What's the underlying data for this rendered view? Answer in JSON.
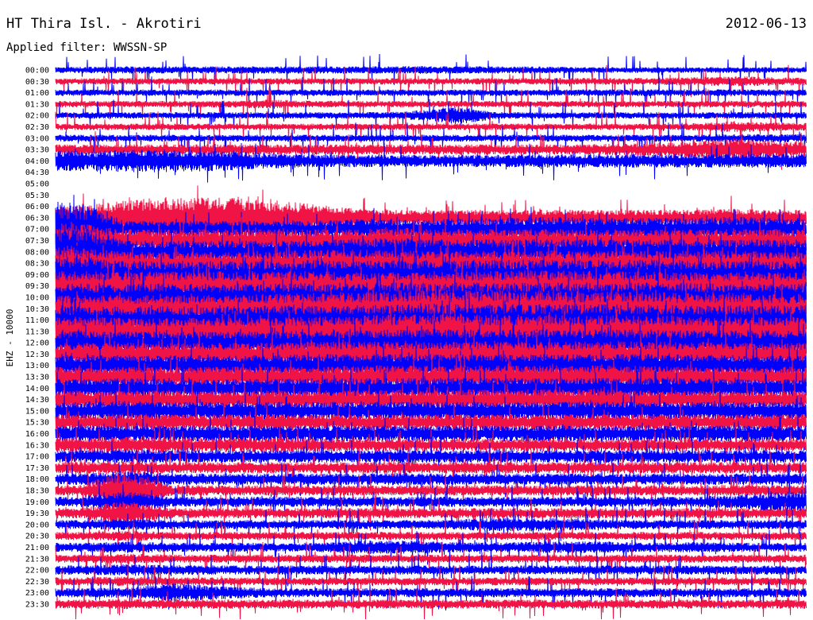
{
  "chart_data": {
    "type": "line",
    "title": "HT Thira Isl. - Akrotiri",
    "date": "2012-06-13",
    "subtitle": "Applied filter: WWSSN-SP",
    "ylabel": "EHZ - 10000",
    "grid": false,
    "background": "#ffffff",
    "series": [
      {
        "name": "00:00",
        "color": "#0000ff",
        "amplitude": [
          0.28,
          0.32,
          0.32,
          0.32,
          0.32,
          0.32,
          0.32,
          0.35,
          0.32,
          0.32,
          0.3,
          0.25,
          0.25,
          0.25,
          0.25,
          0.25
        ]
      },
      {
        "name": "00:30",
        "color": "#f01446",
        "amplitude": [
          0.28,
          0.28,
          0.28,
          0.28,
          0.28,
          0.28,
          0.28,
          0.28,
          0.28,
          0.28,
          0.3,
          0.3,
          0.3,
          0.35,
          0.45,
          0.35
        ]
      },
      {
        "name": "01:00",
        "color": "#0000ff",
        "amplitude": [
          0.28,
          0.28,
          0.28,
          0.28,
          0.28,
          0.28,
          0.28,
          0.28,
          0.28,
          0.28,
          0.28,
          0.3,
          0.3,
          0.3,
          0.3,
          0.3
        ]
      },
      {
        "name": "01:30",
        "color": "#f01446",
        "amplitude": [
          0.28,
          0.28,
          0.28,
          0.3,
          0.4,
          0.3,
          0.28,
          0.28,
          0.28,
          0.28,
          0.28,
          0.28,
          0.28,
          0.28,
          0.3,
          0.3
        ]
      },
      {
        "name": "02:00",
        "color": "#0000ff",
        "amplitude": [
          0.28,
          0.28,
          0.28,
          0.28,
          0.28,
          0.28,
          0.28,
          0.35,
          0.8,
          0.3,
          0.28,
          0.28,
          0.28,
          0.28,
          0.3,
          0.3
        ]
      },
      {
        "name": "02:30",
        "color": "#f01446",
        "amplitude": [
          0.28,
          0.28,
          0.28,
          0.28,
          0.28,
          0.28,
          0.28,
          0.28,
          0.28,
          0.28,
          0.28,
          0.28,
          0.28,
          0.3,
          0.5,
          0.35
        ]
      },
      {
        "name": "03:00",
        "color": "#0000ff",
        "amplitude": [
          0.3,
          0.3,
          0.3,
          0.3,
          0.3,
          0.3,
          0.3,
          0.3,
          0.3,
          0.3,
          0.3,
          0.3,
          0.3,
          0.3,
          0.35,
          0.35
        ]
      },
      {
        "name": "03:30",
        "color": "#f01446",
        "amplitude": [
          0.45,
          0.45,
          0.45,
          0.45,
          0.45,
          0.45,
          0.45,
          0.45,
          0.45,
          0.45,
          0.45,
          0.5,
          0.55,
          0.7,
          1.0,
          0.75
        ]
      },
      {
        "name": "04:00",
        "color": "#0000ff",
        "amplitude": [
          0.9,
          1.0,
          1.0,
          0.9,
          0.7,
          0.55,
          0.55,
          0.55,
          0.55,
          0.55,
          0.6,
          0.6,
          0.6,
          0.6,
          0.6,
          0.6
        ]
      },
      {
        "name": "04:30",
        "color": "#f01446",
        "amplitude": [
          null,
          null,
          null,
          null,
          null,
          null,
          null,
          null,
          null,
          null,
          null,
          null,
          null,
          null,
          null,
          null
        ]
      },
      {
        "name": "05:00",
        "color": "#0000ff",
        "amplitude": [
          null,
          null,
          null,
          null,
          null,
          null,
          null,
          null,
          null,
          null,
          null,
          null,
          null,
          null,
          null,
          null
        ]
      },
      {
        "name": "05:30",
        "color": "#f01446",
        "amplitude": [
          null,
          null,
          null,
          null,
          null,
          null,
          null,
          null,
          null,
          null,
          null,
          null,
          null,
          null,
          null,
          null
        ]
      },
      {
        "name": "06:00",
        "color": "#0000ff",
        "amplitude": [
          null,
          null,
          null,
          null,
          null,
          null,
          null,
          null,
          null,
          null,
          null,
          null,
          null,
          null,
          null,
          null
        ]
      },
      {
        "name": "06:30",
        "color": "#f01446",
        "amplitude": [
          1.0,
          1.6,
          1.9,
          1.8,
          1.6,
          1.2,
          0.8,
          0.7,
          0.7,
          0.7,
          0.7,
          0.7,
          0.7,
          0.7,
          0.8,
          0.7
        ]
      },
      {
        "name": "07:00",
        "color": "#0000ff",
        "amplitude": [
          2.4,
          0.7,
          0.7,
          0.7,
          0.7,
          0.7,
          0.9,
          0.9,
          0.9,
          1.0,
          1.1,
          1.0,
          1.0,
          1.0,
          1.1,
          1.0
        ]
      },
      {
        "name": "07:30",
        "color": "#f01446",
        "amplitude": [
          1.5,
          1.0,
          1.0,
          1.0,
          1.0,
          1.0,
          1.0,
          1.1,
          1.0,
          1.0,
          1.0,
          1.0,
          1.0,
          1.0,
          1.0,
          1.0
        ]
      },
      {
        "name": "08:00",
        "color": "#0000ff",
        "amplitude": [
          2.4,
          1.0,
          1.0,
          1.0,
          1.0,
          1.0,
          1.2,
          1.2,
          1.1,
          1.1,
          1.1,
          1.1,
          1.1,
          1.1,
          1.1,
          1.1
        ]
      },
      {
        "name": "08:30",
        "color": "#f01446",
        "amplitude": [
          1.4,
          1.0,
          1.0,
          1.0,
          1.0,
          1.2,
          1.2,
          1.1,
          1.1,
          1.1,
          1.1,
          1.1,
          1.1,
          1.1,
          1.1,
          1.0
        ]
      },
      {
        "name": "09:00",
        "color": "#0000ff",
        "amplitude": [
          1.6,
          1.2,
          1.2,
          1.2,
          1.2,
          1.3,
          1.2,
          1.3,
          1.3,
          1.3,
          1.3,
          1.3,
          1.3,
          1.2,
          1.2,
          1.2
        ]
      },
      {
        "name": "09:30",
        "color": "#f01446",
        "amplitude": [
          1.3,
          1.3,
          1.3,
          1.3,
          1.3,
          1.3,
          1.2,
          1.3,
          1.3,
          1.3,
          1.4,
          1.3,
          1.3,
          1.2,
          1.2,
          1.2
        ]
      },
      {
        "name": "10:00",
        "color": "#0000ff",
        "amplitude": [
          1.2,
          1.2,
          1.2,
          1.2,
          1.2,
          1.3,
          1.3,
          1.3,
          1.3,
          1.3,
          1.3,
          1.3,
          1.3,
          1.3,
          1.2,
          1.2
        ]
      },
      {
        "name": "10:30",
        "color": "#f01446",
        "amplitude": [
          1.2,
          1.2,
          1.2,
          1.2,
          1.3,
          1.4,
          1.5,
          1.7,
          1.7,
          1.6,
          1.6,
          1.5,
          1.5,
          1.4,
          1.4,
          1.3
        ]
      },
      {
        "name": "11:00",
        "color": "#0000ff",
        "amplitude": [
          1.2,
          1.2,
          1.2,
          1.2,
          1.3,
          1.3,
          1.3,
          1.4,
          1.4,
          1.4,
          1.4,
          1.4,
          1.4,
          1.3,
          1.3,
          1.3
        ]
      },
      {
        "name": "11:30",
        "color": "#f01446",
        "amplitude": [
          1.3,
          1.2,
          1.2,
          1.2,
          1.2,
          1.3,
          1.4,
          1.5,
          1.6,
          1.5,
          1.5,
          1.4,
          1.4,
          1.3,
          1.3,
          1.3
        ]
      },
      {
        "name": "12:00",
        "color": "#0000ff",
        "amplitude": [
          1.0,
          1.0,
          1.0,
          1.0,
          1.0,
          1.1,
          1.1,
          1.2,
          1.2,
          1.2,
          1.2,
          1.2,
          1.2,
          1.1,
          1.1,
          1.1
        ]
      },
      {
        "name": "12:30",
        "color": "#f01446",
        "amplitude": [
          1.0,
          1.0,
          1.0,
          1.0,
          1.0,
          1.1,
          1.1,
          1.1,
          1.1,
          1.1,
          1.1,
          1.1,
          1.1,
          1.1,
          1.0,
          1.0
        ]
      },
      {
        "name": "13:00",
        "color": "#0000ff",
        "amplitude": [
          0.9,
          0.9,
          0.9,
          0.9,
          0.9,
          1.0,
          1.0,
          1.0,
          1.0,
          1.0,
          1.0,
          1.0,
          1.0,
          1.0,
          0.9,
          0.9
        ]
      },
      {
        "name": "13:30",
        "color": "#f01446",
        "amplitude": [
          0.9,
          0.9,
          0.9,
          0.9,
          0.9,
          0.9,
          1.0,
          1.0,
          1.0,
          1.0,
          1.0,
          1.0,
          1.0,
          0.9,
          0.9,
          0.9
        ]
      },
      {
        "name": "14:00",
        "color": "#0000ff",
        "amplitude": [
          0.8,
          0.9,
          0.8,
          0.8,
          0.8,
          0.9,
          0.9,
          0.9,
          0.9,
          0.9,
          0.9,
          0.9,
          0.9,
          0.9,
          0.8,
          0.8
        ]
      },
      {
        "name": "14:30",
        "color": "#f01446",
        "amplitude": [
          0.8,
          0.8,
          0.8,
          0.8,
          0.8,
          0.8,
          0.8,
          0.9,
          0.9,
          0.9,
          0.9,
          0.9,
          0.8,
          0.8,
          0.8,
          0.8
        ]
      },
      {
        "name": "15:00",
        "color": "#0000ff",
        "amplitude": [
          0.8,
          0.9,
          0.8,
          0.8,
          0.8,
          0.8,
          0.8,
          0.8,
          0.8,
          0.8,
          0.8,
          0.8,
          0.8,
          0.8,
          0.8,
          0.8
        ]
      },
      {
        "name": "15:30",
        "color": "#f01446",
        "amplitude": [
          0.7,
          0.8,
          0.7,
          0.7,
          0.7,
          0.7,
          0.7,
          0.7,
          0.7,
          0.7,
          0.7,
          0.7,
          0.7,
          0.7,
          0.7,
          0.7
        ]
      },
      {
        "name": "16:00",
        "color": "#0000ff",
        "amplitude": [
          0.7,
          0.7,
          0.7,
          0.7,
          0.7,
          0.7,
          0.7,
          0.7,
          0.7,
          0.7,
          0.7,
          0.7,
          0.7,
          0.7,
          0.7,
          0.7
        ]
      },
      {
        "name": "16:30",
        "color": "#f01446",
        "amplitude": [
          0.65,
          0.75,
          0.65,
          0.65,
          0.65,
          0.6,
          0.55,
          0.55,
          0.55,
          0.55,
          0.55,
          0.55,
          0.55,
          0.55,
          0.55,
          0.55
        ]
      },
      {
        "name": "17:00",
        "color": "#0000ff",
        "amplitude": [
          0.55,
          0.6,
          0.55,
          0.55,
          0.55,
          0.55,
          0.55,
          0.6,
          0.55,
          0.55,
          0.55,
          0.55,
          0.55,
          0.55,
          0.55,
          0.55
        ]
      },
      {
        "name": "17:30",
        "color": "#f01446",
        "amplitude": [
          0.5,
          0.6,
          0.5,
          0.5,
          0.5,
          0.5,
          0.5,
          0.5,
          0.5,
          0.5,
          0.5,
          0.5,
          0.5,
          0.5,
          0.5,
          0.5
        ]
      },
      {
        "name": "18:00",
        "color": "#0000ff",
        "amplitude": [
          0.5,
          0.7,
          0.5,
          0.5,
          0.5,
          0.5,
          0.5,
          0.55,
          0.5,
          0.5,
          0.5,
          0.5,
          0.5,
          0.5,
          0.5,
          0.5
        ]
      },
      {
        "name": "18:30",
        "color": "#f01446",
        "amplitude": [
          0.45,
          1.8,
          0.5,
          0.45,
          0.45,
          0.45,
          0.45,
          0.45,
          0.45,
          0.45,
          0.45,
          0.45,
          0.45,
          0.45,
          0.5,
          0.45
        ]
      },
      {
        "name": "19:00",
        "color": "#0000ff",
        "amplitude": [
          0.45,
          0.9,
          0.45,
          0.45,
          0.45,
          0.45,
          0.45,
          0.45,
          0.45,
          0.45,
          0.45,
          0.45,
          0.45,
          0.45,
          0.6,
          0.9
        ]
      },
      {
        "name": "19:30",
        "color": "#f01446",
        "amplitude": [
          0.45,
          1.1,
          0.45,
          0.45,
          0.45,
          0.45,
          0.45,
          0.45,
          0.45,
          0.45,
          0.45,
          0.45,
          0.45,
          0.45,
          0.45,
          0.45
        ]
      },
      {
        "name": "20:00",
        "color": "#0000ff",
        "amplitude": [
          0.4,
          0.5,
          0.4,
          0.4,
          0.4,
          0.4,
          0.4,
          0.4,
          0.45,
          0.6,
          0.6,
          0.45,
          0.4,
          0.4,
          0.4,
          0.4
        ]
      },
      {
        "name": "20:30",
        "color": "#f01446",
        "amplitude": [
          0.35,
          0.45,
          0.35,
          0.35,
          0.35,
          0.35,
          0.35,
          0.35,
          0.35,
          0.35,
          0.35,
          0.35,
          0.35,
          0.35,
          0.35,
          0.35
        ]
      },
      {
        "name": "21:00",
        "color": "#0000ff",
        "amplitude": [
          0.4,
          0.5,
          0.4,
          0.4,
          0.4,
          0.4,
          0.6,
          0.6,
          0.45,
          0.45,
          0.5,
          0.55,
          0.4,
          0.45,
          0.4,
          0.4
        ]
      },
      {
        "name": "21:30",
        "color": "#f01446",
        "amplitude": [
          0.35,
          0.45,
          0.35,
          0.35,
          0.35,
          0.35,
          0.35,
          0.35,
          0.35,
          0.35,
          0.35,
          0.35,
          0.35,
          0.35,
          0.35,
          0.35
        ]
      },
      {
        "name": "22:00",
        "color": "#0000ff",
        "amplitude": [
          0.4,
          0.5,
          0.45,
          0.4,
          0.4,
          0.4,
          0.4,
          0.4,
          0.4,
          0.4,
          0.4,
          0.4,
          0.4,
          0.4,
          0.4,
          0.4
        ]
      },
      {
        "name": "22:30",
        "color": "#f01446",
        "amplitude": [
          0.35,
          0.45,
          0.35,
          0.35,
          0.35,
          0.35,
          0.35,
          0.35,
          0.35,
          0.35,
          0.35,
          0.35,
          0.35,
          0.35,
          0.35,
          0.35
        ]
      },
      {
        "name": "23:00",
        "color": "#0000ff",
        "amplitude": [
          0.4,
          0.45,
          0.8,
          0.6,
          0.4,
          0.4,
          0.4,
          0.4,
          0.4,
          0.4,
          0.4,
          0.4,
          0.4,
          0.4,
          0.4,
          0.4
        ]
      },
      {
        "name": "23:30",
        "color": "#f01446",
        "amplitude": [
          0.4,
          0.45,
          0.4,
          0.4,
          0.4,
          0.4,
          0.4,
          0.4,
          0.4,
          0.4,
          0.4,
          0.4,
          0.4,
          0.4,
          0.4,
          0.4
        ]
      }
    ]
  }
}
